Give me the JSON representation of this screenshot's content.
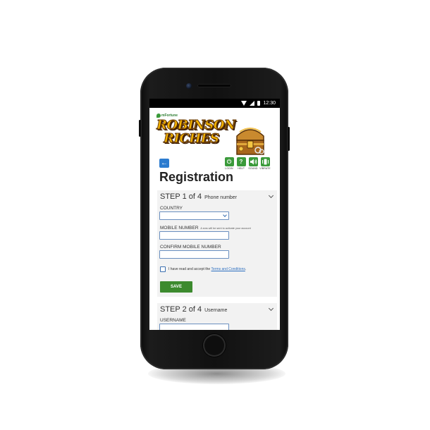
{
  "status_bar": {
    "time": "12:30"
  },
  "banner": {
    "brand": "mFortune",
    "title_line1": "ROBINSON",
    "title_line2": "RICHES"
  },
  "toolbar": {
    "back_glyph": "←",
    "buttons": [
      {
        "label": "LOGIN",
        "icon": "power-icon",
        "glyph": "⏻"
      },
      {
        "label": "HELP",
        "icon": "help-icon",
        "glyph": "?"
      },
      {
        "label": "SOUND",
        "icon": "sound-icon",
        "glyph": "🔊"
      },
      {
        "label": "VIBRATE",
        "icon": "vibrate-icon",
        "glyph": "📳"
      }
    ]
  },
  "page_title": "Registration",
  "step1": {
    "heading": "STEP 1 of 4",
    "subheading": "Phone number",
    "country_label": "COUNTRY",
    "country_value": "",
    "mobile_label": "MOBILE NUMBER",
    "mobile_hint": "A sms will be sent to activate your account",
    "mobile_value": "",
    "confirm_label": "CONFIRM MOBILE NUMBER",
    "confirm_value": "",
    "terms_prefix": "I have read and accept the ",
    "terms_link": "Terms and Conditions",
    "terms_suffix": ".",
    "save_label": "SAVE"
  },
  "step2": {
    "heading": "STEP 2 of 4",
    "subheading": "Username",
    "username_label": "USERNAME",
    "username_value": ""
  },
  "colors": {
    "primary_green": "#3c8a2e",
    "icon_green": "#3a9a3a",
    "back_blue": "#2d7ccf",
    "link_blue": "#2d6fc0",
    "title_gold": "#f4b400"
  }
}
